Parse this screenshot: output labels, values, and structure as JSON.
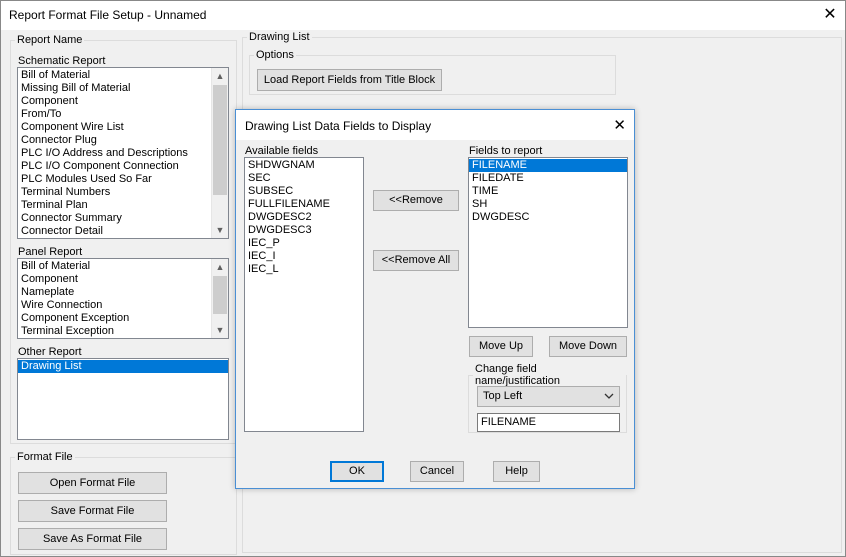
{
  "window": {
    "title": "Report Format File Setup - Unnamed",
    "close_glyph": "✕"
  },
  "report_name": {
    "group_label": "Report Name",
    "schematic": {
      "label": "Schematic Report",
      "items": [
        "Bill of Material",
        "Missing Bill of Material",
        "Component",
        "From/To",
        "Component Wire List",
        "Connector Plug",
        "PLC I/O Address and Descriptions",
        "PLC I/O Component Connection",
        "PLC Modules Used So Far",
        "Terminal Numbers",
        "Terminal Plan",
        "Connector Summary",
        "Connector Detail"
      ]
    },
    "panel": {
      "label": "Panel Report",
      "items": [
        "Bill of Material",
        "Component",
        "Nameplate",
        "Wire Connection",
        "Component Exception",
        "Terminal Exception"
      ]
    },
    "other": {
      "label": "Other Report",
      "items": [
        "Drawing List"
      ],
      "selected": "Drawing List"
    }
  },
  "format_file": {
    "group_label": "Format File",
    "open": "Open Format File",
    "save": "Save Format File",
    "save_as": "Save As Format File"
  },
  "drawing_list": {
    "group_label": "Drawing List",
    "options_label": "Options",
    "load_button": "Load Report Fields from Title Block"
  },
  "dialog": {
    "title": "Drawing List Data Fields to Display",
    "close_glyph": "✕",
    "available_label": "Available fields",
    "available": [
      "SHDWGNAM",
      "SEC",
      "SUBSEC",
      "FULLFILENAME",
      "DWGDESC2",
      "DWGDESC3",
      "IEC_P",
      "IEC_I",
      "IEC_L"
    ],
    "report_label": "Fields to report",
    "report": [
      "FILENAME",
      "FILEDATE",
      "TIME",
      "SH",
      "DWGDESC"
    ],
    "report_selected": "FILENAME",
    "remove": "<<Remove",
    "remove_all": "<<Remove All",
    "move_up": "Move Up",
    "move_down": "Move Down",
    "change_label": "Change field name/justification",
    "justification": "Top Left",
    "field_name": "FILENAME",
    "ok": "OK",
    "cancel": "Cancel",
    "help": "Help"
  },
  "colors": {
    "accent": "#0078d7",
    "dialog_border": "#4a8fd4",
    "face": "#f0f0f0"
  },
  "icons": {
    "scroll_up": "scroll-up-arrow-icon",
    "scroll_down": "scroll-down-arrow-icon",
    "close": "close-icon",
    "dropdown": "chevron-down-icon"
  }
}
